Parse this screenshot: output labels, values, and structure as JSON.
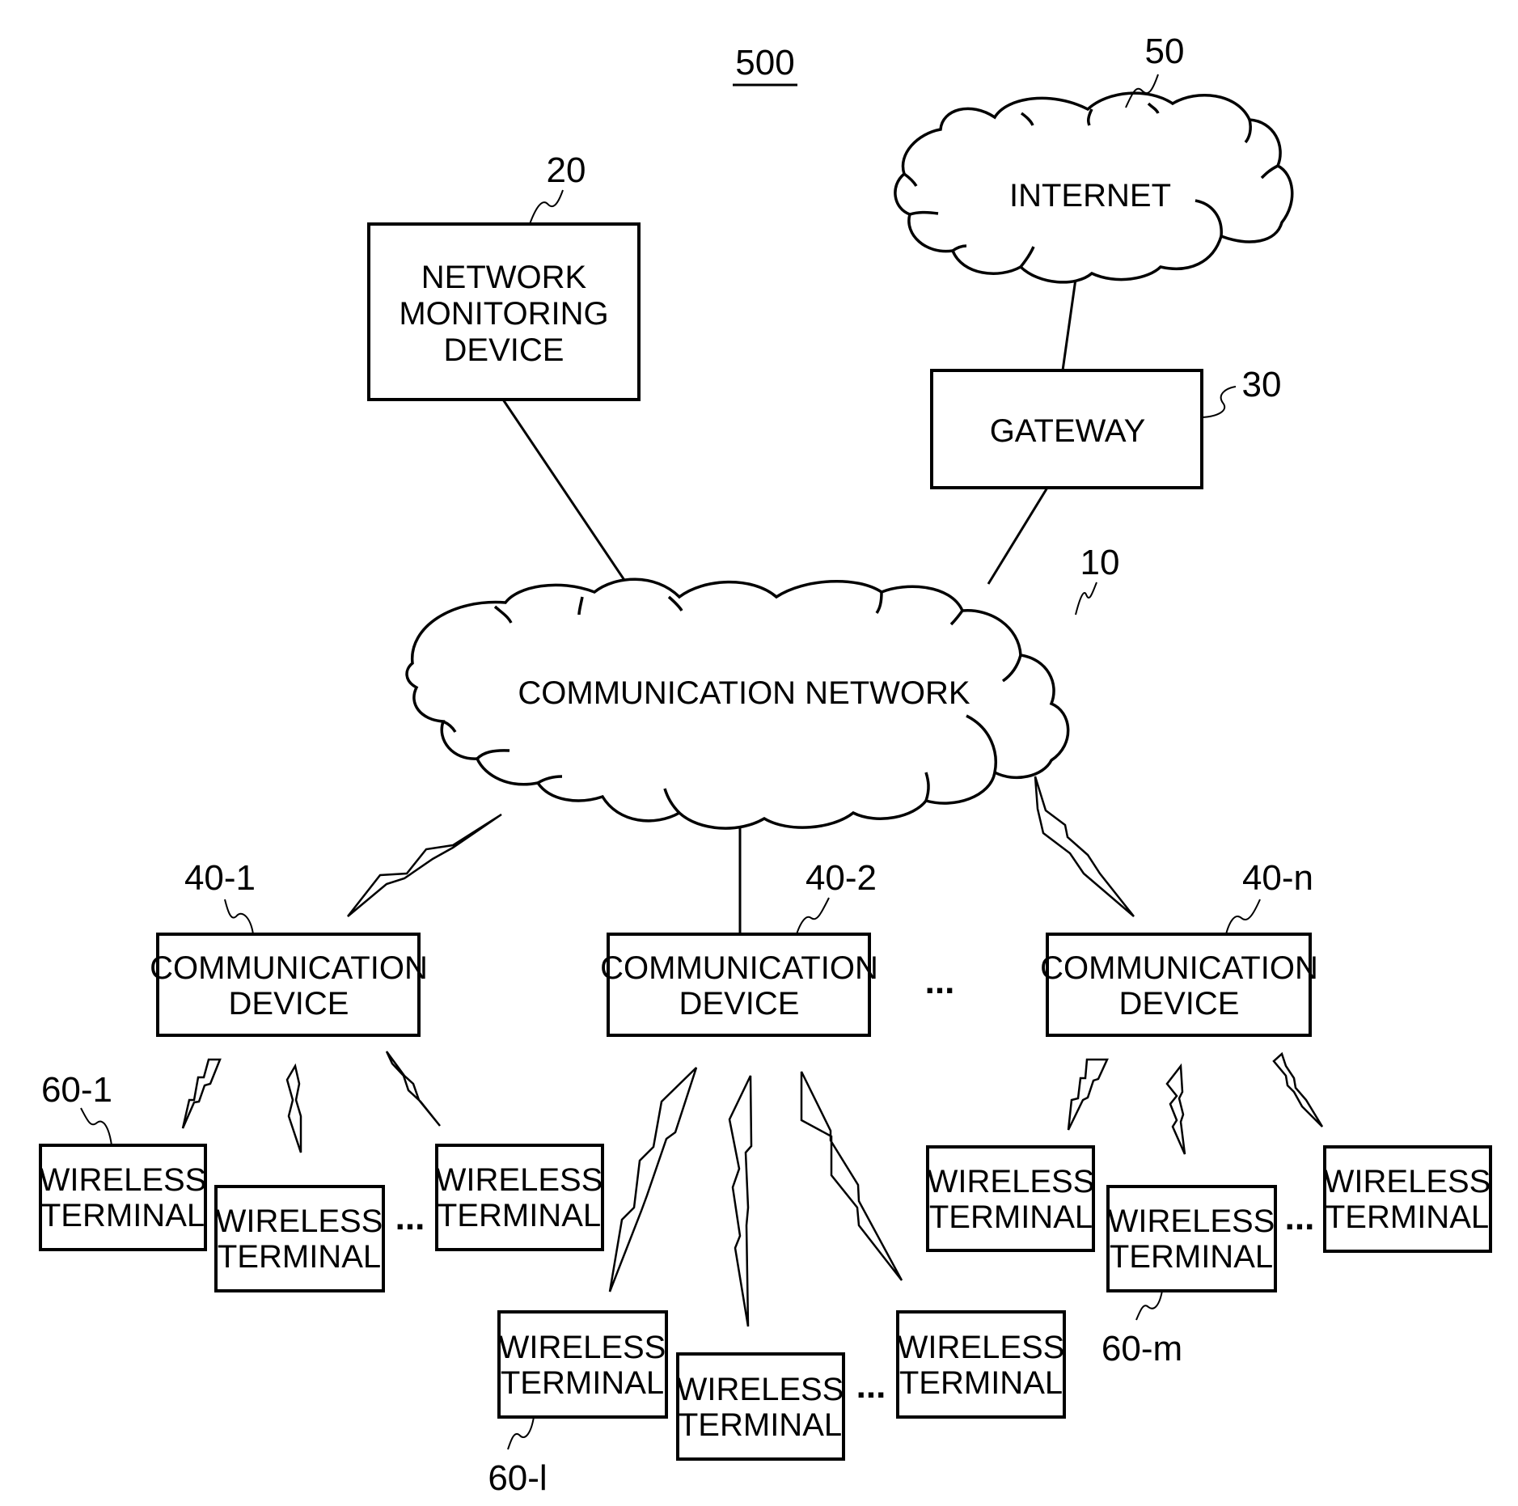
{
  "figure": {
    "number": "500"
  },
  "nodes": {
    "internet": {
      "label": "INTERNET",
      "ref": "50"
    },
    "network_monitoring_device": {
      "lines": [
        "NETWORK",
        "MONITORING",
        "DEVICE"
      ],
      "ref": "20"
    },
    "gateway": {
      "label": "GATEWAY",
      "ref": "30"
    },
    "communication_network": {
      "label": "COMMUNICATION NETWORK",
      "ref": "10"
    },
    "communication_devices": [
      {
        "lines": [
          "COMMUNICATION",
          "DEVICE"
        ],
        "ref": "40-1",
        "link": "wireless"
      },
      {
        "lines": [
          "COMMUNICATION",
          "DEVICE"
        ],
        "ref": "40-2",
        "link": "wired"
      },
      {
        "lines": [
          "COMMUNICATION",
          "DEVICE"
        ],
        "ref": "40-n",
        "link": "wireless"
      }
    ],
    "wireless_terminal": {
      "lines": [
        "WIRELESS",
        "TERMINAL"
      ]
    },
    "terminal_groups": [
      {
        "device": "40-1",
        "refs": [
          "60-1",
          "",
          ""
        ]
      },
      {
        "device": "40-2",
        "refs": [
          "60-l",
          "",
          ""
        ]
      },
      {
        "device": "40-n",
        "refs": [
          "",
          "60-m",
          ""
        ]
      }
    ]
  },
  "ellipsis": "..."
}
